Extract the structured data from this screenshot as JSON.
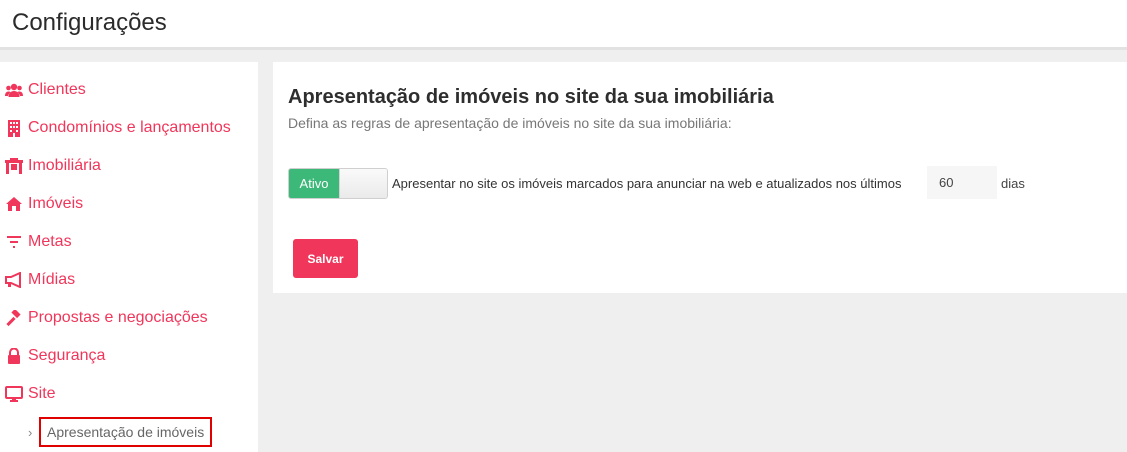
{
  "header": {
    "title": "Configurações"
  },
  "sidebar": {
    "items": [
      {
        "label": "Clientes",
        "icon": "users-icon"
      },
      {
        "label": "Condomínios e lançamentos",
        "icon": "building-icon"
      },
      {
        "label": "Imobiliária",
        "icon": "office-icon"
      },
      {
        "label": "Imóveis",
        "icon": "home-icon"
      },
      {
        "label": "Metas",
        "icon": "filter-icon"
      },
      {
        "label": "Mídias",
        "icon": "megaphone-icon"
      },
      {
        "label": "Propostas e negociações",
        "icon": "gavel-icon"
      },
      {
        "label": "Segurança",
        "icon": "lock-icon"
      },
      {
        "label": "Site",
        "icon": "desktop-icon"
      }
    ],
    "sub_item": {
      "label": "Apresentação de imóveis",
      "icon": "chevron-right-icon"
    }
  },
  "content": {
    "title": "Apresentação de imóveis no site da sua imobiliária",
    "subtitle": "Defina as regras de apresentação de imóveis no site da sua imobiliária:",
    "toggle": {
      "label": "Ativo",
      "state": "on"
    },
    "rule_text": "Apresentar no site os imóveis marcados para anunciar na web e atualizados nos últimos",
    "days_value": "60",
    "days_label": "dias",
    "save_label": "Salvar"
  },
  "colors": {
    "accent": "#f0365a",
    "toggle_on": "#3cb878",
    "highlight_border": "#e00000"
  }
}
